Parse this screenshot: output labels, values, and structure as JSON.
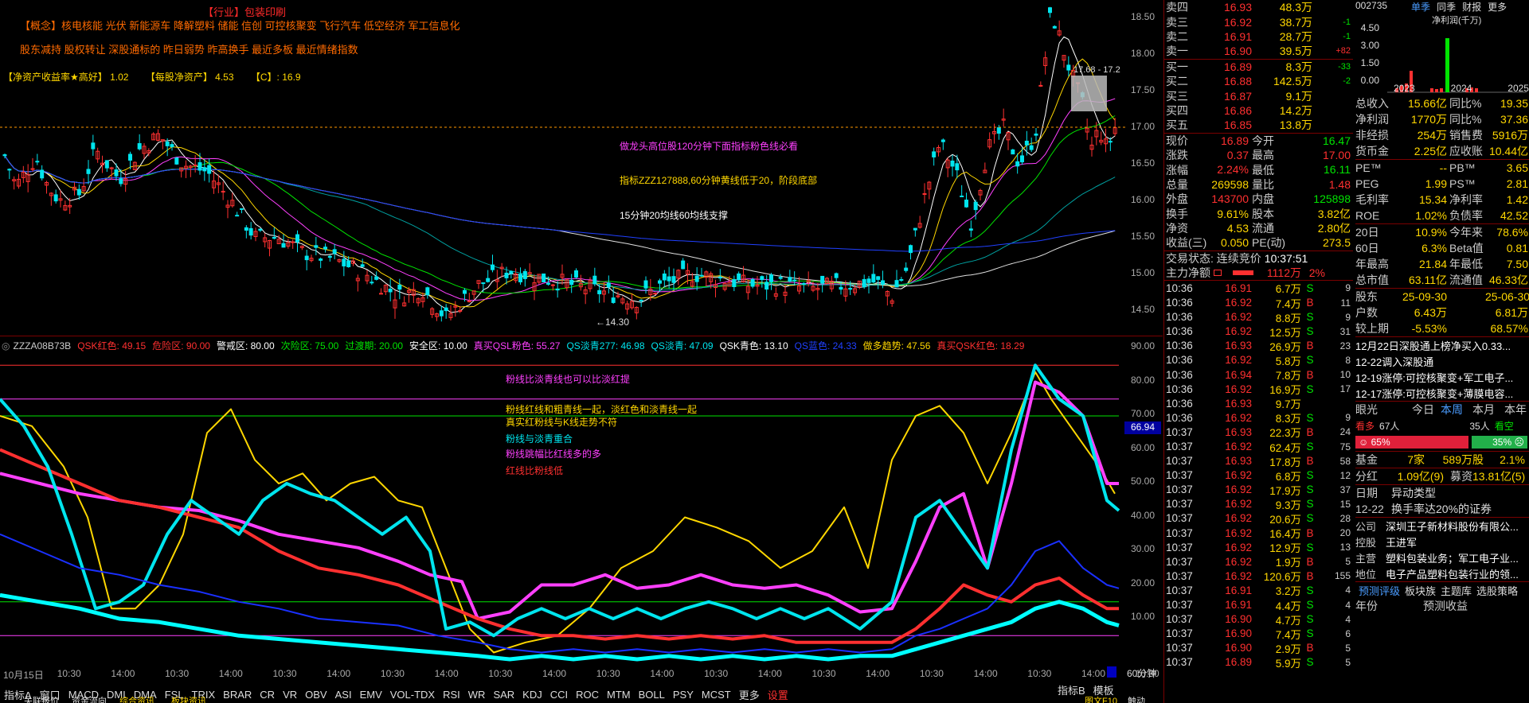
{
  "header": {
    "industry_label": "【行业】包装印刷",
    "concept_line": "【概念】核电核能 光伏 新能源车 降解塑料 储能 信创 可控核聚变 飞行汽车 低空经济 军工信息化",
    "concept_line2": "股东减持 股权转让 深股通标的 昨日弱势 昨高换手 最近多板 最近情绪指数",
    "roe_label": "【净资产收益率★高好】",
    "roe_value": "1.02",
    "bvps_label": "【每股净资产】",
    "bvps_value": "4.53",
    "c_label": "【C】:",
    "c_value": "16.9"
  },
  "annotations": {
    "a1": "做龙头高位股120分钟下面指标粉色线必看",
    "a2": "指标ZZZ127888,60分钟黄线低于20，阶段底部",
    "a3": "15分钟20均线60均线支撑",
    "low_label": "←14.30",
    "box_label": "17.68 - 17.2"
  },
  "price_axis": [
    "18.50",
    "18.00",
    "17.50",
    "17.00",
    "16.50",
    "16.00",
    "15.50",
    "15.00",
    "14.50"
  ],
  "osc_header": [
    {
      "t": "ZZZA08B73B",
      "c": "#cccccc"
    },
    {
      "t": "QSK红色: 49.15",
      "c": "#ff3030"
    },
    {
      "t": "危险区: 90.00",
      "c": "#ff3030"
    },
    {
      "t": "警戒区: 80.00",
      "c": "#ffffff"
    },
    {
      "t": "次险区: 75.00",
      "c": "#00e400"
    },
    {
      "t": "过渡期: 20.00",
      "c": "#00e400"
    },
    {
      "t": "安全区: 10.00",
      "c": "#ffffff"
    },
    {
      "t": "真买QSL粉色: 55.27",
      "c": "#ff40ff"
    },
    {
      "t": "QS淡青277: 46.98",
      "c": "#00e5ee"
    },
    {
      "t": "QS淡青: 47.09",
      "c": "#00e5ee"
    },
    {
      "t": "QSK青色: 13.10",
      "c": "#ffffff"
    },
    {
      "t": "QS蓝色: 24.33",
      "c": "#2040ff"
    },
    {
      "t": "做多趋势: 47.56",
      "c": "#ffd700"
    },
    {
      "t": "真买QSK红色: 18.29",
      "c": "#ff3030"
    }
  ],
  "osc_notes": [
    {
      "t": "粉线比淡青线也可以比淡红提",
      "c": "#ff40ff"
    },
    {
      "t": "粉线红线和粗青线一起，淡红色和淡青线一起",
      "c": "#ffd700"
    },
    {
      "t": "真实红粉线与K线走势不符",
      "c": "#ffd700"
    },
    {
      "t": "粉线与淡青重合",
      "c": "#00e5ee"
    },
    {
      "t": "粉线跳幅比红线多的多",
      "c": "#ff40ff"
    },
    {
      "t": "红线比粉线低",
      "c": "#ff3030"
    }
  ],
  "osc_axis": [
    "90.00",
    "80.00",
    "70.00",
    "60.00",
    "50.00",
    "40.00",
    "30.00",
    "20.00",
    "10.00"
  ],
  "osc_current": "66.94",
  "time_axis": [
    "10月15日",
    "10:30",
    "14:00",
    "10:30",
    "14:00",
    "10:30",
    "14:00",
    "10:30",
    "14:00",
    "10:30",
    "14:00",
    "10:30",
    "14:00",
    "10:30",
    "14:00",
    "10:30",
    "14:00",
    "10:30",
    "14:00",
    "10:30",
    "14:00",
    "10:30"
  ],
  "period": "60分钟",
  "indicator_tabs": [
    "指标A",
    "窗口",
    "MACD",
    "DMI",
    "DMA",
    "FSL",
    "TRIX",
    "BRAR",
    "CR",
    "VR",
    "OBV",
    "ASI",
    "EMV",
    "VOL-TDX",
    "RSI",
    "WR",
    "SAR",
    "KDJ",
    "CCI",
    "ROC",
    "MTM",
    "BOLL",
    "PSY",
    "MCST",
    "更多",
    "设置"
  ],
  "bottom_right": {
    "a": "指标B",
    "b": "模板"
  },
  "order_book": {
    "asks": [
      {
        "l": "卖四",
        "p": "16.93",
        "v": "48.3万",
        "c": ""
      },
      {
        "l": "卖三",
        "p": "16.92",
        "v": "38.7万",
        "c": "-1"
      },
      {
        "l": "卖二",
        "p": "16.91",
        "v": "28.7万",
        "c": "-1"
      },
      {
        "l": "卖一",
        "p": "16.90",
        "v": "39.5万",
        "c": "+82"
      }
    ],
    "bids": [
      {
        "l": "买一",
        "p": "16.89",
        "v": "8.3万",
        "c": "-33"
      },
      {
        "l": "买二",
        "p": "16.88",
        "v": "142.5万",
        "c": "-2"
      },
      {
        "l": "买三",
        "p": "16.87",
        "v": "9.1万",
        "c": ""
      },
      {
        "l": "买四",
        "p": "16.86",
        "v": "14.2万",
        "c": ""
      },
      {
        "l": "买五",
        "p": "16.85",
        "v": "13.8万",
        "c": ""
      }
    ]
  },
  "stats": [
    {
      "k": "现价",
      "v": "16.89",
      "k2": "今开",
      "v2": "16.47",
      "c1": "#ff3030",
      "c2": "#00e400"
    },
    {
      "k": "涨跌",
      "v": "0.37",
      "k2": "最高",
      "v2": "17.00",
      "c1": "#ff3030",
      "c2": "#ff3030"
    },
    {
      "k": "涨幅",
      "v": "2.24%",
      "k2": "最低",
      "v2": "16.11",
      "c1": "#ff3030",
      "c2": "#00e400"
    },
    {
      "k": "总量",
      "v": "269598",
      "k2": "量比",
      "v2": "1.48",
      "c1": "#ffd700",
      "c2": "#ff3030"
    },
    {
      "k": "外盘",
      "v": "143700",
      "k2": "内盘",
      "v2": "125898",
      "c1": "#ff3030",
      "c2": "#00e400"
    },
    {
      "k": "换手",
      "v": "9.61%",
      "k2": "股本",
      "v2": "3.82亿",
      "c1": "#ffd700",
      "c2": "#ffd700"
    },
    {
      "k": "净资",
      "v": "4.53",
      "k2": "流通",
      "v2": "2.80亿",
      "c1": "#ffd700",
      "c2": "#ffd700"
    },
    {
      "k": "收益(三)",
      "v": "0.050",
      "k2": "PE(动)",
      "v2": "273.5",
      "c1": "#ffd700",
      "c2": "#ffd700"
    }
  ],
  "trade_status": {
    "label": "交易状态: 连续竞价",
    "time": "10:37:51"
  },
  "main_net": {
    "label": "主力净额",
    "value": "1112万",
    "pct": "2%"
  },
  "ticks": [
    [
      "10:36",
      "16.91",
      "6.7万",
      "S",
      "9"
    ],
    [
      "10:36",
      "16.92",
      "7.4万",
      "B",
      "11"
    ],
    [
      "10:36",
      "16.92",
      "8.8万",
      "S",
      "9"
    ],
    [
      "10:36",
      "16.92",
      "12.5万",
      "S",
      "31"
    ],
    [
      "10:36",
      "16.93",
      "26.9万",
      "B",
      "23"
    ],
    [
      "10:36",
      "16.92",
      "5.8万",
      "S",
      "8"
    ],
    [
      "10:36",
      "16.94",
      "7.8万",
      "B",
      "10"
    ],
    [
      "10:36",
      "16.92",
      "16.9万",
      "S",
      "17"
    ],
    [
      "10:36",
      "16.93",
      "9.7万",
      "",
      ""
    ],
    [
      "10:36",
      "16.92",
      "8.3万",
      "S",
      "9"
    ],
    [
      "10:37",
      "16.93",
      "22.3万",
      "B",
      "24"
    ],
    [
      "10:37",
      "16.92",
      "62.4万",
      "S",
      "75"
    ],
    [
      "10:37",
      "16.93",
      "17.8万",
      "B",
      "58"
    ],
    [
      "10:37",
      "16.92",
      "6.8万",
      "S",
      "12"
    ],
    [
      "10:37",
      "16.92",
      "17.9万",
      "S",
      "37"
    ],
    [
      "10:37",
      "16.92",
      "9.3万",
      "S",
      "15"
    ],
    [
      "10:37",
      "16.92",
      "20.6万",
      "S",
      "28"
    ],
    [
      "10:37",
      "16.92",
      "16.4万",
      "B",
      "20"
    ],
    [
      "10:37",
      "16.92",
      "12.9万",
      "S",
      "13"
    ],
    [
      "10:37",
      "16.92",
      "1.9万",
      "B",
      "5"
    ],
    [
      "10:37",
      "16.92",
      "120.6万",
      "B",
      "155"
    ],
    [
      "10:37",
      "16.91",
      "3.2万",
      "S",
      "4"
    ],
    [
      "10:37",
      "16.91",
      "4.4万",
      "S",
      "4"
    ],
    [
      "10:37",
      "16.90",
      "4.7万",
      "S",
      "4"
    ],
    [
      "10:37",
      "16.90",
      "7.4万",
      "S",
      "6"
    ],
    [
      "10:37",
      "16.90",
      "2.9万",
      "B",
      "5"
    ],
    [
      "10:37",
      "16.89",
      "5.9万",
      "S",
      "5"
    ]
  ],
  "fin": {
    "code": "002735",
    "tabs": [
      "单季",
      "同季",
      "财报",
      "更多"
    ],
    "chart_title": "净利润(千万)",
    "chart_ticks": [
      "4.50",
      "3.00",
      "1.50",
      "0.00"
    ],
    "years": [
      "2023",
      "2024",
      "2025"
    ],
    "rows1": [
      {
        "k": "总收入",
        "v": "15.66亿",
        "k2": "同比%",
        "v2": "19.35"
      },
      {
        "k": "净利润",
        "v": "1770万",
        "k2": "同比%",
        "v2": "37.36"
      },
      {
        "k": "非经损",
        "v": "254万",
        "k2": "销售费",
        "v2": "5916万"
      },
      {
        "k": "货币金",
        "v": "2.25亿",
        "k2": "应收账",
        "v2": "10.44亿"
      }
    ],
    "rows2": [
      {
        "k": "PE™",
        "v": "--",
        "k2": "PB™",
        "v2": "3.65"
      },
      {
        "k": "PEG",
        "v": "1.99",
        "k2": "PS™",
        "v2": "2.81"
      },
      {
        "k": "毛利率",
        "v": "15.34",
        "k2": "净利率",
        "v2": "1.42"
      },
      {
        "k": "ROE",
        "v": "1.02%",
        "k2": "负债率",
        "v2": "42.52"
      }
    ],
    "rows3": [
      {
        "k": "20日",
        "v": "10.9%",
        "k2": "今年来",
        "v2": "78.6%"
      },
      {
        "k": "60日",
        "v": "6.3%",
        "k2": "Beta值",
        "v2": "0.81"
      },
      {
        "k": "年最高",
        "v": "21.84",
        "k2": "年最低",
        "v2": "7.50"
      },
      {
        "k": "总市值",
        "v": "63.11亿",
        "k2": "流通值",
        "v2": "46.33亿"
      }
    ],
    "rows4": [
      {
        "k": "股东",
        "v": "25-09-30",
        "k2": "",
        "v2": "25-06-30"
      },
      {
        "k": "户数",
        "v": "6.43万",
        "k2": "",
        "v2": "6.81万"
      },
      {
        "k": "较上期",
        "v": "-5.53%",
        "k2": "",
        "v2": "68.57%"
      }
    ],
    "news": [
      "12月22日深股通上榜净买入0.33...",
      "12-22调入深股通",
      "12-19涨停:可控核聚变+军工电子...",
      "12-17涨停:可控核聚变+薄膜电容..."
    ],
    "vision": {
      "label": "眼光",
      "today": "今日",
      "week": "本周",
      "month": "本月",
      "year": "本年",
      "bull": "看多",
      "bull_n": "67人",
      "bear_n": "35人",
      "bear": "看空",
      "bull_pct": "65%",
      "bear_pct": "35%"
    },
    "fund": {
      "k": "基金",
      "v1": "7家",
      "v2": "589万股",
      "v3": "2.1%"
    },
    "div": {
      "k": "分红",
      "v1": "1.09亿(9)",
      "k2": "募资",
      "v2": "13.81亿(5)"
    },
    "date_hdr": {
      "k": "日期",
      "v": "异动类型"
    },
    "date_row": {
      "k": "12-22",
      "v": "换手率达20%的证券"
    },
    "company": [
      {
        "k": "公司",
        "v": "深圳王子新材料股份有限公..."
      },
      {
        "k": "控股",
        "v": "王进军"
      },
      {
        "k": "主营",
        "v": "塑料包装业务；军工电子业..."
      },
      {
        "k": "地位",
        "v": "电子产品塑料包装行业的领..."
      }
    ],
    "bottom_tabs": [
      "预测评级",
      "板块族",
      "主题库",
      "选股策略"
    ],
    "last_row": {
      "k": "年份",
      "v": "预测收益"
    }
  },
  "footer": {
    "a": "关联报价",
    "b": "资金流向",
    "c": "综合资讯",
    "d": "板块资讯",
    "e": "图文F10",
    "f": "触动"
  },
  "colors": {
    "up": "#ff3030",
    "down": "#00e400",
    "accent": "#ffd700",
    "border": "#7a0000"
  }
}
